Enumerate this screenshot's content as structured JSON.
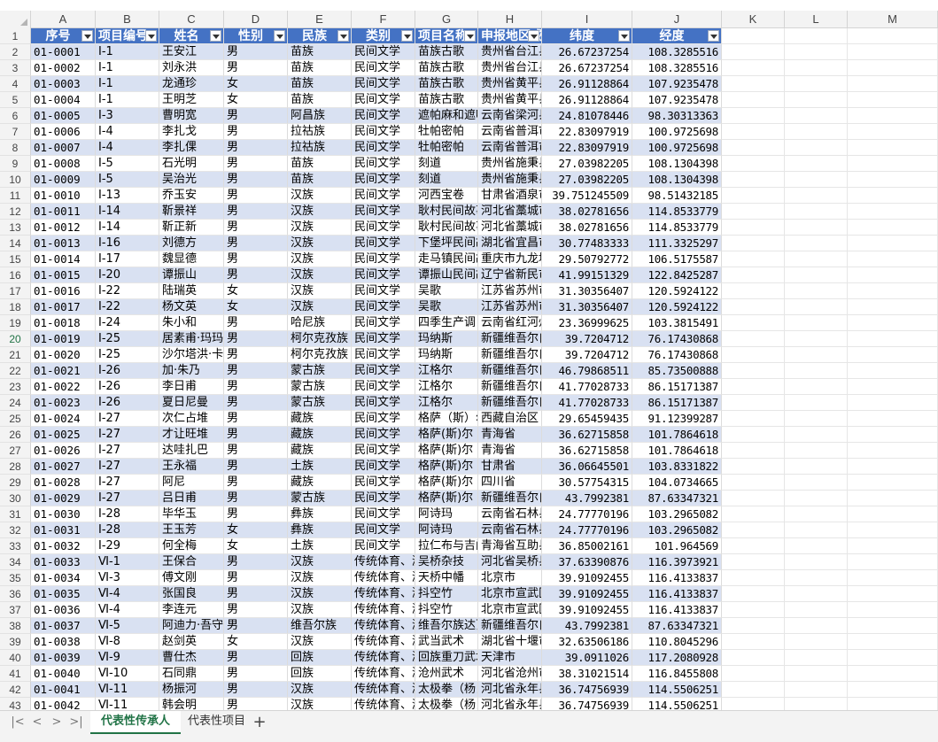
{
  "columns": [
    "A",
    "B",
    "C",
    "D",
    "E",
    "F",
    "G",
    "H",
    "I",
    "J",
    "K",
    "L",
    "M"
  ],
  "headers": [
    "序号",
    "项目编号",
    "姓名",
    "性别",
    "民族",
    "类别",
    "项目名称",
    "申报地区或单位",
    "纬度",
    "经度"
  ],
  "rows": [
    [
      "01-0001",
      "Ⅰ-1",
      "王安江",
      "男",
      "苗族",
      "民间文学",
      "苗族古歌",
      "贵州省台江县",
      "26.67237254",
      "108.3285516"
    ],
    [
      "01-0002",
      "Ⅰ-1",
      "刘永洪",
      "男",
      "苗族",
      "民间文学",
      "苗族古歌",
      "贵州省台江县",
      "26.67237254",
      "108.3285516"
    ],
    [
      "01-0003",
      "Ⅰ-1",
      "龙通珍",
      "女",
      "苗族",
      "民间文学",
      "苗族古歌",
      "贵州省黄平县",
      "26.91128864",
      "107.9235478"
    ],
    [
      "01-0004",
      "Ⅰ-1",
      "王明芝",
      "女",
      "苗族",
      "民间文学",
      "苗族古歌",
      "贵州省黄平县",
      "26.91128864",
      "107.9235478"
    ],
    [
      "01-0005",
      "Ⅰ-3",
      "曹明宽",
      "男",
      "阿昌族",
      "民间文学",
      "遮帕麻和遮咪麻",
      "云南省梁河县",
      "24.81078446",
      "98.30313363"
    ],
    [
      "01-0006",
      "Ⅰ-4",
      "李扎戈",
      "男",
      "拉祜族",
      "民间文学",
      "牡帕密帕",
      "云南省普洱市",
      "22.83097919",
      "100.9725698"
    ],
    [
      "01-0007",
      "Ⅰ-4",
      "李扎倮",
      "男",
      "拉祜族",
      "民间文学",
      "牡帕密帕",
      "云南省普洱市",
      "22.83097919",
      "100.9725698"
    ],
    [
      "01-0008",
      "Ⅰ-5",
      "石光明",
      "男",
      "苗族",
      "民间文学",
      "刻道",
      "贵州省施秉县",
      "27.03982205",
      "108.1304398"
    ],
    [
      "01-0009",
      "Ⅰ-5",
      "吴治光",
      "男",
      "苗族",
      "民间文学",
      "刻道",
      "贵州省施秉县",
      "27.03982205",
      "108.1304398"
    ],
    [
      "01-0010",
      "Ⅰ-13",
      "乔玉安",
      "男",
      "汉族",
      "民间文学",
      "河西宝卷",
      "甘肃省酒泉市",
      "39.751245509",
      "98.51432185"
    ],
    [
      "01-0011",
      "Ⅰ-14",
      "靳景祥",
      "男",
      "汉族",
      "民间文学",
      "耿村民间故事",
      "河北省藁城市",
      "38.02781656",
      "114.8533779"
    ],
    [
      "01-0012",
      "Ⅰ-14",
      "靳正新",
      "男",
      "汉族",
      "民间文学",
      "耿村民间故事",
      "河北省藁城市",
      "38.02781656",
      "114.8533779"
    ],
    [
      "01-0013",
      "Ⅰ-16",
      "刘德方",
      "男",
      "汉族",
      "民间文学",
      "下堡坪民间故事",
      "湖北省宜昌市",
      "30.77483333",
      "111.3325297"
    ],
    [
      "01-0014",
      "Ⅰ-17",
      "魏显德",
      "男",
      "汉族",
      "民间文学",
      "走马镇民间故事",
      "重庆市九龙坡区",
      "29.50792772",
      "106.5175587"
    ],
    [
      "01-0015",
      "Ⅰ-20",
      "谭振山",
      "男",
      "汉族",
      "民间文学",
      "谭振山民间故事",
      "辽宁省新民市",
      "41.99151329",
      "122.8425287"
    ],
    [
      "01-0016",
      "Ⅰ-22",
      "陆瑞英",
      "女",
      "汉族",
      "民间文学",
      "吴歌",
      "江苏省苏州市",
      "31.30356407",
      "120.5924122"
    ],
    [
      "01-0017",
      "Ⅰ-22",
      "杨文英",
      "女",
      "汉族",
      "民间文学",
      "吴歌",
      "江苏省苏州市",
      "31.30356407",
      "120.5924122"
    ],
    [
      "01-0018",
      "Ⅰ-24",
      "朱小和",
      "男",
      "哈尼族",
      "民间文学",
      "四季生产调",
      "云南省红河州",
      "23.36999625",
      "103.3815491"
    ],
    [
      "01-0019",
      "Ⅰ-25",
      "居素甫·玛玛依",
      "男",
      "柯尔克孜族",
      "民间文学",
      "玛纳斯",
      "新疆维吾尔自治区",
      "39.7204712",
      "76.17430868"
    ],
    [
      "01-0020",
      "Ⅰ-25",
      "沙尔塔洪·卡德尔",
      "男",
      "柯尔克孜族",
      "民间文学",
      "玛纳斯",
      "新疆维吾尔自治区",
      "39.7204712",
      "76.17430868"
    ],
    [
      "01-0021",
      "Ⅰ-26",
      "加·朱乃",
      "男",
      "蒙古族",
      "民间文学",
      "江格尔",
      "新疆维吾尔自治区",
      "46.79868511",
      "85.73500888"
    ],
    [
      "01-0022",
      "Ⅰ-26",
      "李日甫",
      "男",
      "蒙古族",
      "民间文学",
      "江格尔",
      "新疆维吾尔自治区",
      "41.77028733",
      "86.15171387"
    ],
    [
      "01-0023",
      "Ⅰ-26",
      "夏日尼曼",
      "男",
      "蒙古族",
      "民间文学",
      "江格尔",
      "新疆维吾尔自治区",
      "41.77028733",
      "86.15171387"
    ],
    [
      "01-0024",
      "Ⅰ-27",
      "次仁占堆",
      "男",
      "藏族",
      "民间文学",
      "格萨（斯）尔",
      "西藏自治区",
      "29.65459435",
      "91.12399287"
    ],
    [
      "01-0025",
      "Ⅰ-27",
      "才让旺堆",
      "男",
      "藏族",
      "民间文学",
      "格萨(斯)尔",
      "青海省",
      "36.62715858",
      "101.7864618"
    ],
    [
      "01-0026",
      "Ⅰ-27",
      "达哇扎巴",
      "男",
      "藏族",
      "民间文学",
      "格萨(斯)尔",
      "青海省",
      "36.62715858",
      "101.7864618"
    ],
    [
      "01-0027",
      "Ⅰ-27",
      "王永福",
      "男",
      "土族",
      "民间文学",
      "格萨(斯)尔",
      "甘肃省",
      "36.06645501",
      "103.8331822"
    ],
    [
      "01-0028",
      "Ⅰ-27",
      "阿尼",
      "男",
      "藏族",
      "民间文学",
      "格萨(斯)尔",
      "四川省",
      "30.57754315",
      "104.0734665"
    ],
    [
      "01-0029",
      "Ⅰ-27",
      "吕日甫",
      "男",
      "蒙古族",
      "民间文学",
      "格萨(斯)尔",
      "新疆维吾尔自治区",
      "43.7992381",
      "87.63347321"
    ],
    [
      "01-0030",
      "Ⅰ-28",
      "毕华玉",
      "男",
      "彝族",
      "民间文学",
      "阿诗玛",
      "云南省石林县",
      "24.77770196",
      "103.2965082"
    ],
    [
      "01-0031",
      "Ⅰ-28",
      "王玉芳",
      "女",
      "彝族",
      "民间文学",
      "阿诗玛",
      "云南省石林县",
      "24.77770196",
      "103.2965082"
    ],
    [
      "01-0032",
      "Ⅰ-29",
      "何全梅",
      "女",
      "土族",
      "民间文学",
      "拉仁布与吉门索",
      "青海省互助县",
      "36.85002161",
      "101.964569"
    ],
    [
      "01-0033",
      "Ⅵ-1",
      "王保合",
      "男",
      "汉族",
      "传统体育、游艺与杂技",
      "吴桥杂技",
      "河北省吴桥县",
      "37.63390876",
      "116.3973921"
    ],
    [
      "01-0034",
      "Ⅵ-3",
      "傅文刚",
      "男",
      "汉族",
      "传统体育、游艺与杂技",
      "天桥中幡",
      "北京市",
      "39.91092455",
      "116.4133837"
    ],
    [
      "01-0035",
      "Ⅵ-4",
      "张国良",
      "男",
      "汉族",
      "传统体育、游艺与杂技",
      "抖空竹",
      "北京市宣武区",
      "39.91092455",
      "116.4133837"
    ],
    [
      "01-0036",
      "Ⅵ-4",
      "李连元",
      "男",
      "汉族",
      "传统体育、游艺与杂技",
      "抖空竹",
      "北京市宣武区",
      "39.91092455",
      "116.4133837"
    ],
    [
      "01-0037",
      "Ⅵ-5",
      "阿迪力·吾守尔",
      "男",
      "维吾尔族",
      "传统体育、游艺与杂技",
      "维吾尔族达瓦孜",
      "新疆维吾尔自治区",
      "43.7992381",
      "87.63347321"
    ],
    [
      "01-0038",
      "Ⅵ-8",
      "赵剑英",
      "女",
      "汉族",
      "传统体育、游艺与杂技",
      "武当武术",
      "湖北省十堰市",
      "32.63506186",
      "110.8045296"
    ],
    [
      "01-0039",
      "Ⅵ-9",
      "曹仕杰",
      "男",
      "回族",
      "传统体育、游艺与杂技",
      "回族重刀武术",
      "天津市",
      "39.0911026",
      "117.2080928"
    ],
    [
      "01-0040",
      "Ⅵ-10",
      "石同鼎",
      "男",
      "回族",
      "传统体育、游艺与杂技",
      "沧州武术",
      "河北省沧州市",
      "38.31021514",
      "116.8455808"
    ],
    [
      "01-0041",
      "Ⅵ-11",
      "杨振河",
      "男",
      "汉族",
      "传统体育、游艺与杂技",
      "太极拳（杨氏）",
      "河北省永年县",
      "36.74756939",
      "114.5506251"
    ],
    [
      "01-0042",
      "Ⅵ-11",
      "韩会明",
      "男",
      "汉族",
      "传统体育、游艺与杂技",
      "太极拳（杨氏）",
      "河北省永年县",
      "36.74756939",
      "114.5506251"
    ]
  ],
  "sheet_nav": {
    "first": "|<",
    "prev": "<",
    "next": ">",
    "last": ">|"
  },
  "sheets": [
    {
      "label": "代表性传承人",
      "active": true
    },
    {
      "label": "代表性项目",
      "active": false
    }
  ],
  "add_sheet": "+",
  "colors": {
    "header_bg": "#4472c4",
    "band_bg": "#d9e1f2",
    "active_tab": "#217346"
  }
}
